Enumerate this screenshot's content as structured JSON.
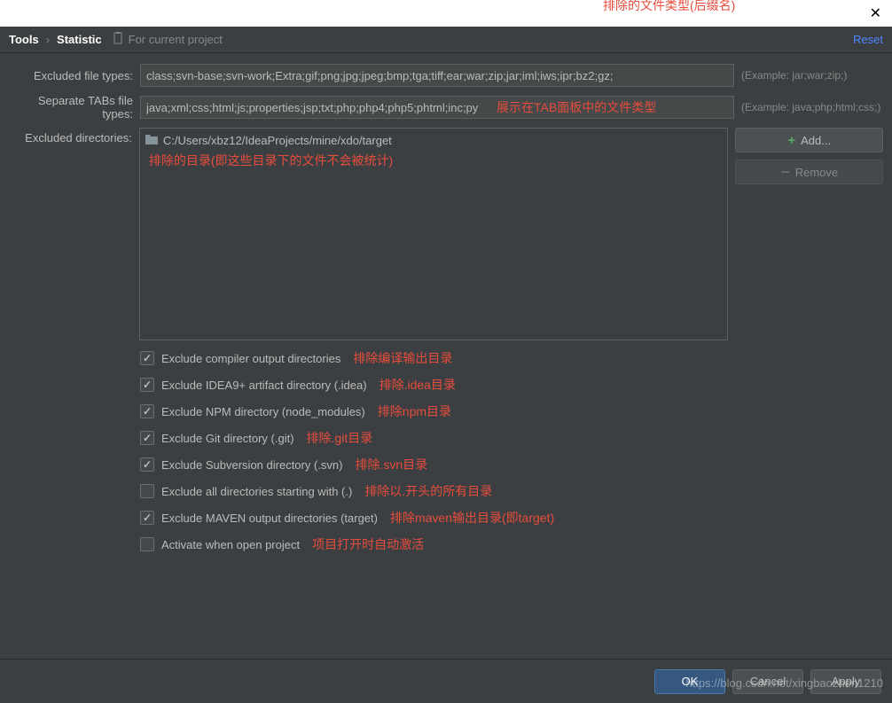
{
  "breadcrumb": {
    "root": "Tools",
    "current": "Statistic",
    "subtitle": "For current project"
  },
  "reset_label": "Reset",
  "labels": {
    "excluded_file_types": "Excluded file types:",
    "separate_tabs": "Separate TABs file types:",
    "excluded_dirs": "Excluded directories:"
  },
  "inputs": {
    "excluded_types_value": "class;svn-base;svn-work;Extra;gif;png;jpg;jpeg;bmp;tga;tiff;ear;war;zip;jar;iml;iws;ipr;bz2;gz;",
    "tab_types_value": "java;xml;css;html;js;properties;jsp;txt;php;php4;php5;phtml;inc;py"
  },
  "examples": {
    "types": "(Example: jar;war;zip;)",
    "tabs": "(Example: java;php;html;css;)"
  },
  "directories": {
    "items": [
      "C:/Users/xbz12/IdeaProjects/mine/xdo/target"
    ]
  },
  "buttons": {
    "add": "Add...",
    "remove": "Remove",
    "ok": "OK",
    "cancel": "Cancel",
    "apply": "Apply"
  },
  "checkboxes": [
    {
      "label": "Exclude compiler output directories",
      "checked": true
    },
    {
      "label": "Exclude IDEA9+ artifact directory (.idea)",
      "checked": true
    },
    {
      "label": "Exclude NPM directory (node_modules)",
      "checked": true
    },
    {
      "label": "Exclude Git directory (.git)",
      "checked": true
    },
    {
      "label": "Exclude Subversion directory (.svn)",
      "checked": true
    },
    {
      "label": "Exclude all directories starting with (.)",
      "checked": false
    },
    {
      "label": "Exclude MAVEN output directories (target)",
      "checked": true
    },
    {
      "label": "Activate when open project",
      "checked": false
    }
  ],
  "annotations": {
    "top_types": "排除的文件类型(后缀名)",
    "tab_types": "展示在TAB面板中的文件类型",
    "dirs": "排除的目录(即这些目录下的文件不会被统计)",
    "cb0": "排除编译输出目录",
    "cb1": "排除.idea目录",
    "cb2": "排除npm目录",
    "cb3": "排除.git目录",
    "cb4": "排除.svn目录",
    "cb5": "排除以.开头的所有目录",
    "cb6": "排除maven输出目录(即target)",
    "cb7": "项目打开时自动激活"
  },
  "watermark": "https://blog.csdn.net/xingbaozhen1210"
}
